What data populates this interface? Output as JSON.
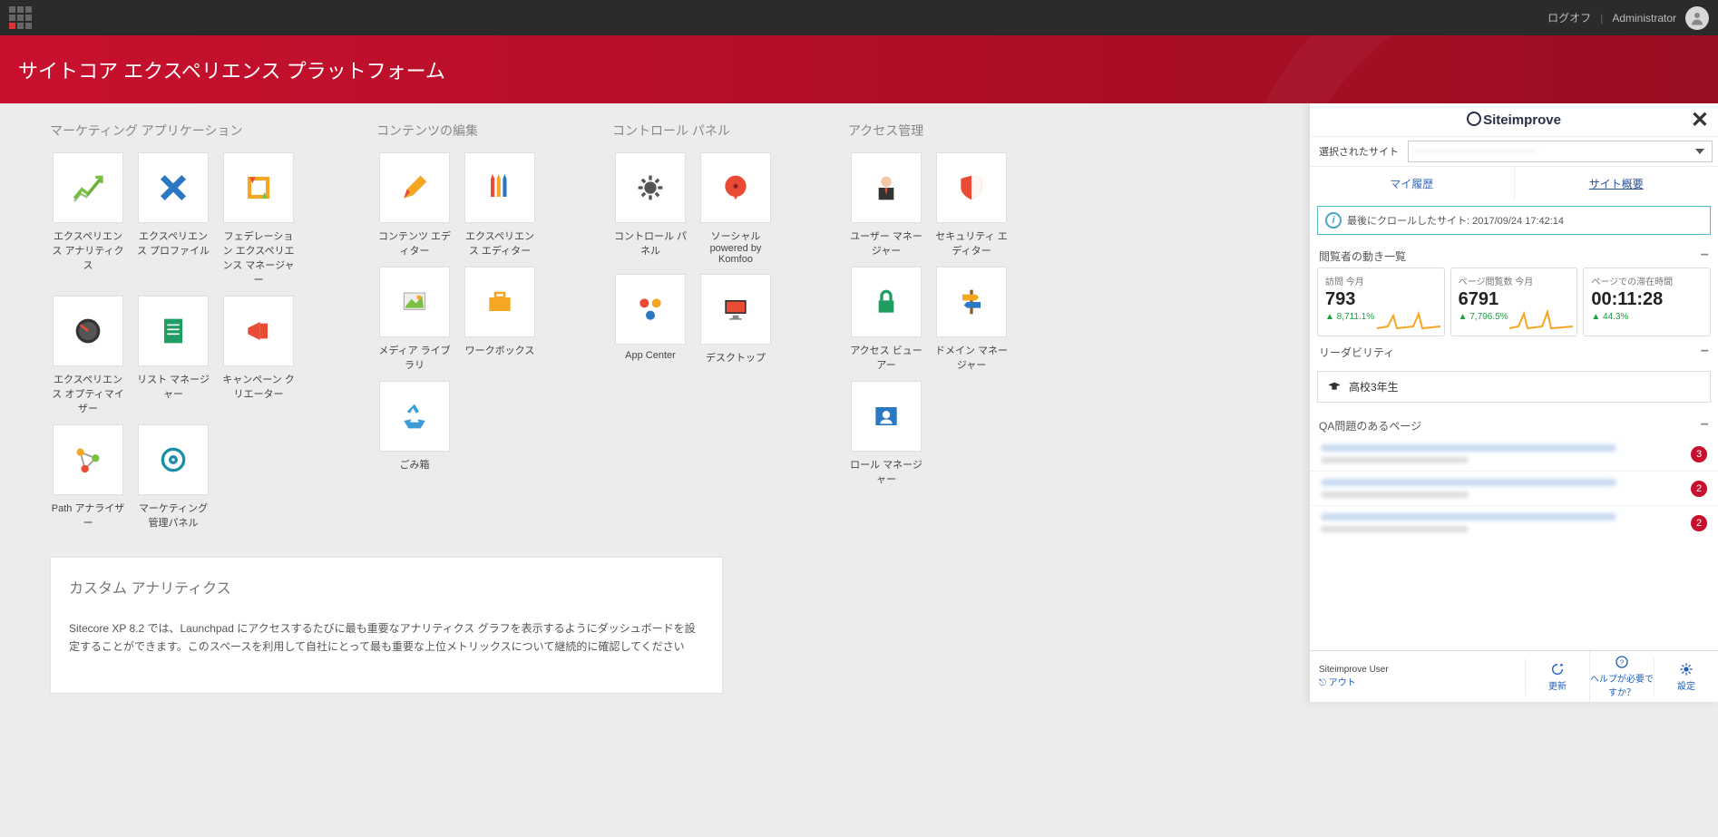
{
  "topbar": {
    "logoff": "ログオフ",
    "username": "Administrator"
  },
  "banner": {
    "title": "サイトコア エクスペリエンス プラットフォーム"
  },
  "groups": {
    "marketing": {
      "title": "マーケティング アプリケーション",
      "tiles": [
        "エクスペリエンス アナリティクス",
        "エクスペリエンス プロファイル",
        "フェデレーション エクスペリエンス マネージャー",
        "エクスペリエンス オプティマイザー",
        "リスト マネージャー",
        "キャンペーン クリエーター",
        "Path アナライザー",
        "マーケティング管理パネル"
      ]
    },
    "content": {
      "title": "コンテンツの編集",
      "tiles": [
        "コンテンツ エディター",
        "エクスペリエンス エディター",
        "メディア ライブラリ",
        "ワークボックス",
        "ごみ箱"
      ]
    },
    "control": {
      "title": "コントロール パネル",
      "tiles": [
        "コントロール パネル",
        "ソーシャル powered by Komfoo",
        "App Center",
        "デスクトップ"
      ]
    },
    "access": {
      "title": "アクセス管理",
      "tiles": [
        "ユーザー マネージャー",
        "セキュリティ エディター",
        "アクセス ビューアー",
        "ドメイン マネージャー",
        "ロール マネージャー"
      ]
    }
  },
  "analytics": {
    "heading": "カスタム アナリティクス",
    "body": "Sitecore XP 8.2 では、Launchpad にアクセスするたびに最も重要なアナリティクス グラフを表示するようにダッシュボードを設定することができます。このスペースを利用して自社にとって最も重要な上位メトリックスについて継続的に確認してください"
  },
  "siteimprove": {
    "brand": "Siteimprove",
    "selected_site_label": "選択されたサイト",
    "selected_site_value": "————————————",
    "tabs": {
      "history": "マイ履歴",
      "overview": "サイト概要"
    },
    "crawl": "最後にクロールしたサイト: 2017/09/24 17:42:14",
    "sections": {
      "visitors_title": "閲覧者の動き一覧",
      "readability_title": "リーダビリティ",
      "readability_value": "高校3年生",
      "qa_title": "QA問題のあるページ"
    },
    "stats": {
      "visits": {
        "label": "訪問 今月",
        "value": "793",
        "delta": "▲ 8,711.1%"
      },
      "pageviews": {
        "label": "ページ閲覧数 今月",
        "value": "6791",
        "delta": "▲ 7,796.5%"
      },
      "timeonpage": {
        "label": "ページでの滞在時間",
        "value": "00:11:28",
        "delta": "▲ 44.3%"
      }
    },
    "qa_badges": [
      "3",
      "2",
      "2"
    ],
    "footer": {
      "user_line1": "Siteimprove User",
      "user_line2": "アウト",
      "refresh": "更新",
      "help": "ヘルプが必要ですか？",
      "settings": "設定"
    }
  }
}
